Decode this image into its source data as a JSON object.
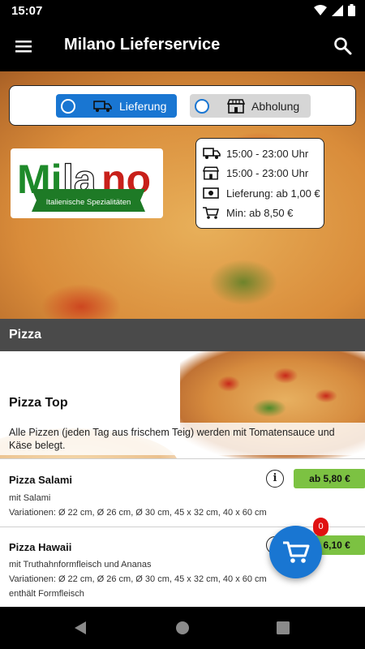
{
  "status_bar": {
    "time": "15:07"
  },
  "app_bar": {
    "title": "Milano Lieferservice"
  },
  "order_mode": {
    "options": [
      {
        "label": "Lieferung",
        "selected": true
      },
      {
        "label": "Abholung",
        "selected": false
      }
    ]
  },
  "logo": {
    "brand_text": "Milano",
    "tagline": "Italienische Spezialitäten"
  },
  "store_info": {
    "delivery_hours": "15:00 - 23:00 Uhr",
    "pickup_hours": "15:00 - 23:00 Uhr",
    "delivery_fee": "Lieferung: ab 1,00 €",
    "min_order": "Min: ab 8,50 €"
  },
  "category": {
    "header": "Pizza",
    "title": "Pizza Top",
    "description": "Alle Pizzen (jeden Tag aus frischem Teig) werden mit Tomatensauce und Käse belegt."
  },
  "items": [
    {
      "name": "Pizza Salami",
      "desc": "mit Salami",
      "variations": "Variationen: Ø 22 cm, Ø 26 cm, Ø 30 cm, 45 x 32 cm, 40 x 60 cm",
      "price": "ab 5,80 €"
    },
    {
      "name": "Pizza Hawaii",
      "desc": "mit Truthahnformfleisch und Ananas",
      "variations": "Variationen: Ø 22 cm, Ø 26 cm, Ø 30 cm, 45 x 32 cm, 40 x 60 cm",
      "note": "enthält Formfleisch",
      "price": "ab 6,10 €"
    }
  ],
  "cart": {
    "count": "0"
  },
  "colors": {
    "primary": "#1976d2",
    "price": "#7cc242",
    "badge": "#e01010",
    "category_header": "#4a4a4a"
  }
}
